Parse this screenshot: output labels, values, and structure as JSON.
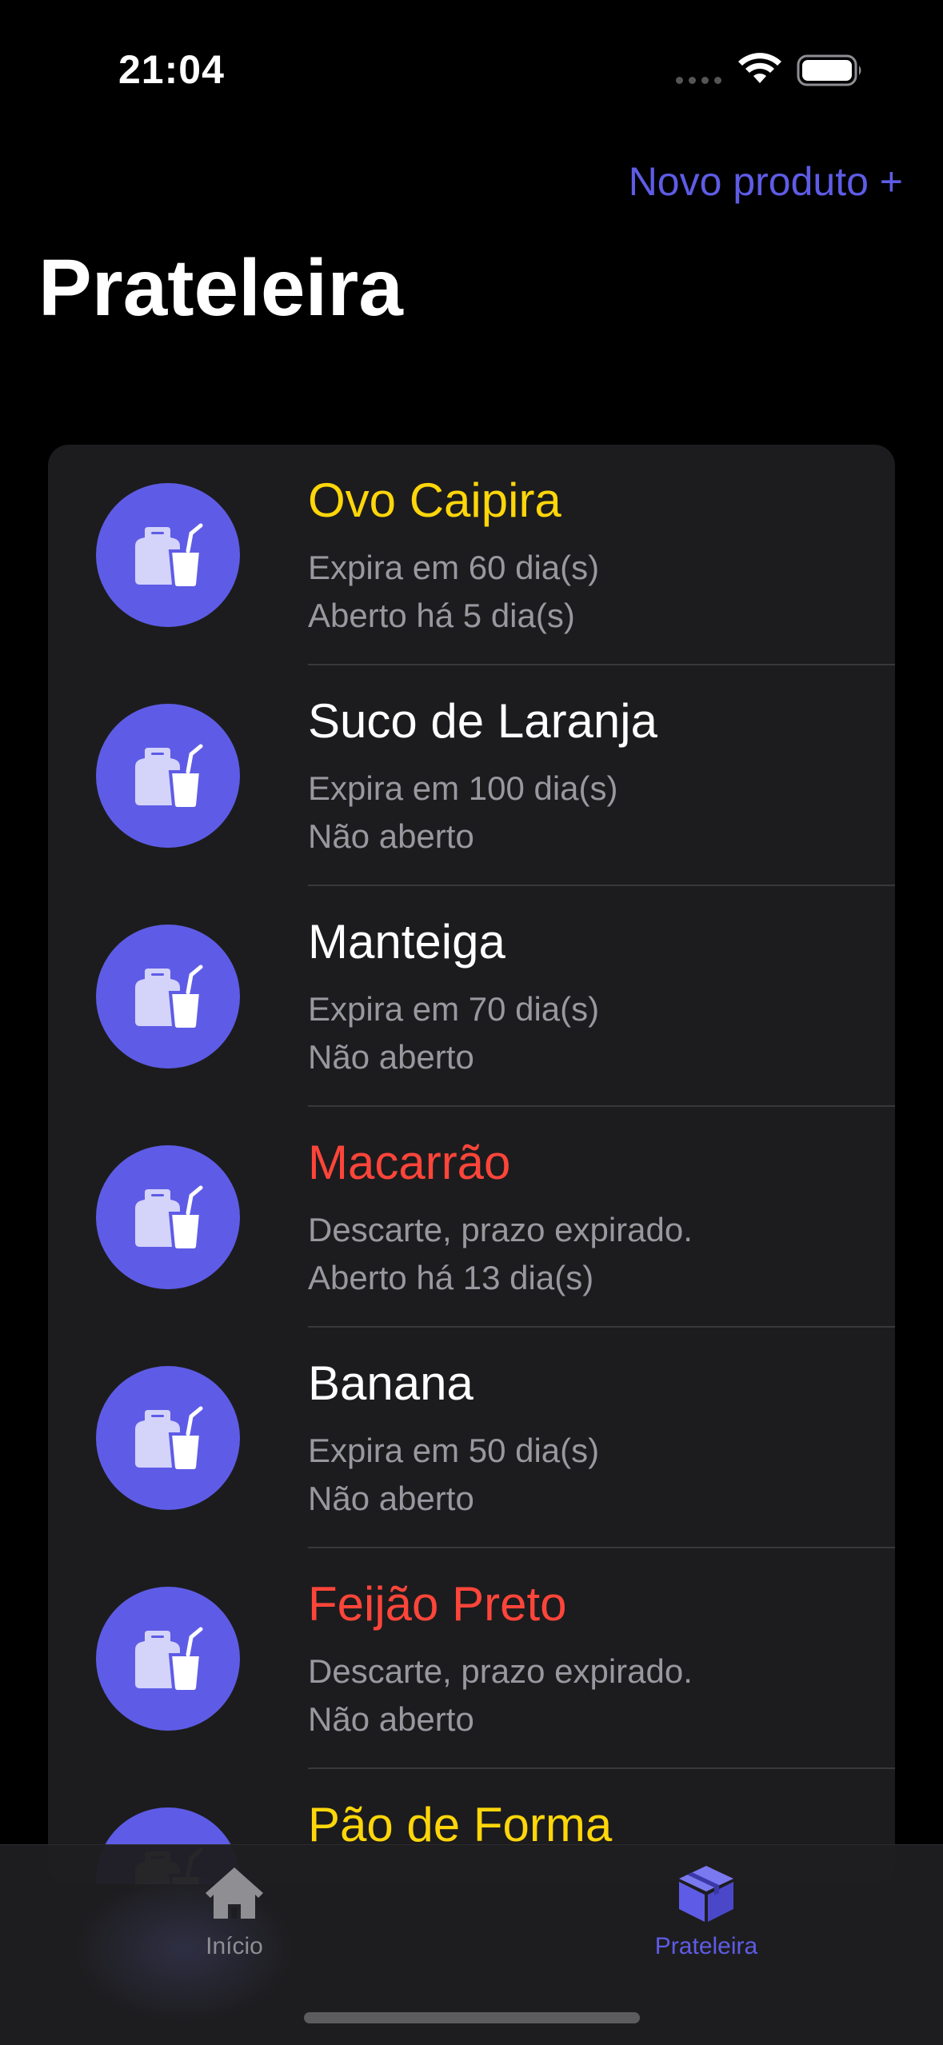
{
  "status_bar": {
    "time": "21:04"
  },
  "nav": {
    "action_label": "Novo produto +",
    "title": "Prateleira"
  },
  "colors": {
    "accent": "#5e5ce6",
    "warning": "#ffd60a",
    "danger": "#ff453a",
    "normal": "#ffffff",
    "secondary_text": "#98989f"
  },
  "products": [
    {
      "name": "Ovo Caipira",
      "status": "warning",
      "line1": "Expira em 60 dia(s)",
      "line2": "Aberto há 5 dia(s)",
      "icon": "product-icon"
    },
    {
      "name": "Suco de Laranja",
      "status": "normal",
      "line1": "Expira em 100 dia(s)",
      "line2": "Não aberto",
      "icon": "product-icon"
    },
    {
      "name": "Manteiga",
      "status": "normal",
      "line1": "Expira em 70 dia(s)",
      "line2": "Não aberto",
      "icon": "product-icon"
    },
    {
      "name": "Macarrão",
      "status": "danger",
      "line1": "Descarte, prazo expirado.",
      "line2": "Aberto há 13 dia(s)",
      "icon": "product-icon"
    },
    {
      "name": "Banana",
      "status": "normal",
      "line1": "Expira em 50 dia(s)",
      "line2": "Não aberto",
      "icon": "product-icon"
    },
    {
      "name": "Feijão Preto",
      "status": "danger",
      "line1": "Descarte, prazo expirado.",
      "line2": "Não aberto",
      "icon": "product-icon"
    },
    {
      "name": "Pão de Forma",
      "status": "warning",
      "line1": "",
      "line2": "",
      "icon": "product-icon"
    }
  ],
  "tab_bar": {
    "tabs": [
      {
        "label": "Início",
        "icon": "house-icon",
        "selected": false
      },
      {
        "label": "Prateleira",
        "icon": "shipping-box-icon",
        "selected": true
      }
    ]
  }
}
